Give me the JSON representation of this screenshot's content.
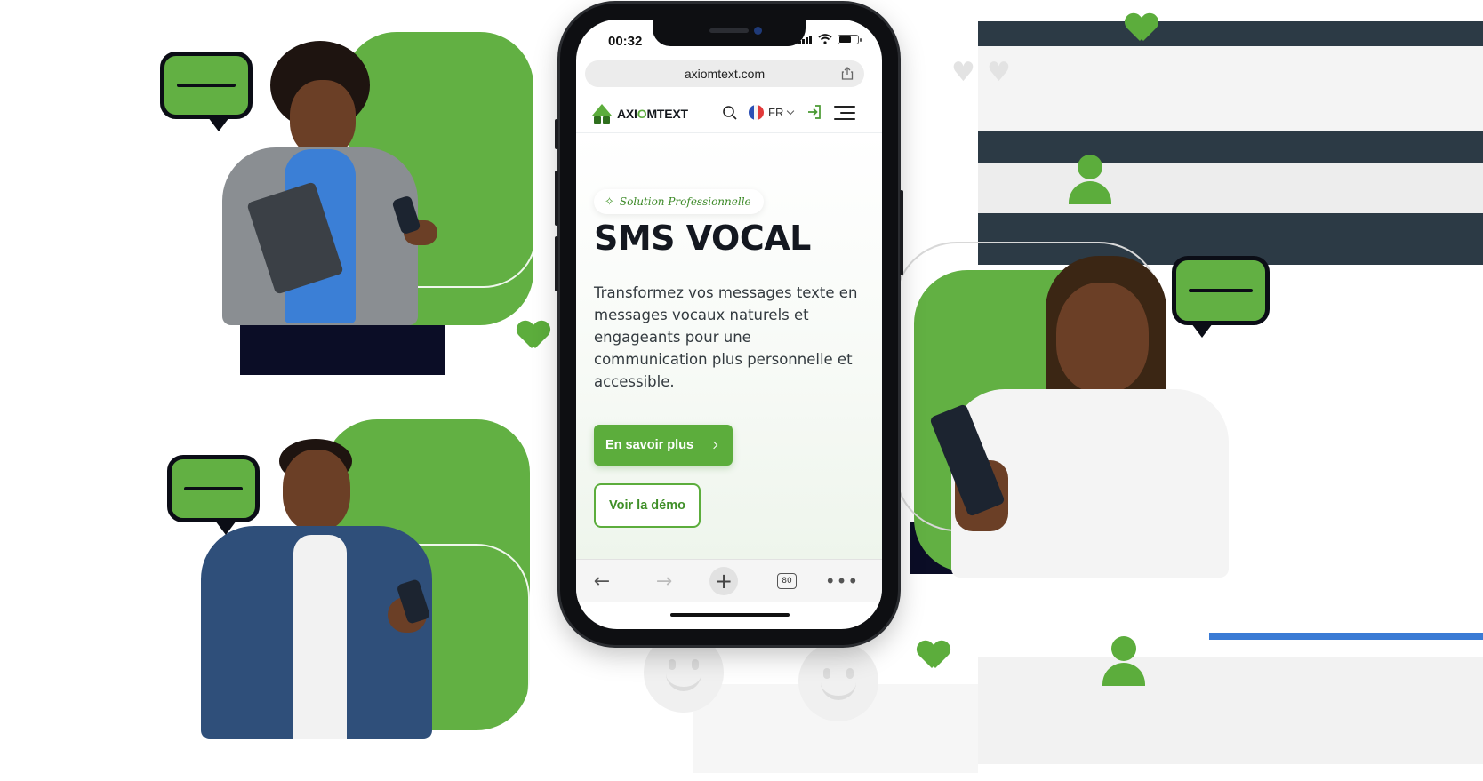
{
  "phone": {
    "status_time": "00:32",
    "url": "axiomtext.com"
  },
  "site": {
    "logo_prefix": "AXI",
    "logo_o": "O",
    "logo_suffix": "MTEXT",
    "lang": "FR",
    "badge": "Solution Professionnelle",
    "title": "SMS VOCAL",
    "description": "Transformez vos messages texte en messages vocaux naturels et engageants pour une communication plus personnelle et accessible.",
    "cta_primary": "En savoir plus",
    "cta_secondary": "Voir la démo"
  },
  "browser": {
    "tab_count": "80"
  },
  "colors": {
    "brand_green": "#5cad3c",
    "dark_navy": "#0b0d26",
    "text_dark": "#141820"
  },
  "icons": [
    "search-icon",
    "flag-fr-icon",
    "login-icon",
    "menu-icon",
    "share-icon",
    "back-icon",
    "forward-icon",
    "plus-icon",
    "tabs-icon",
    "more-icon",
    "sparkle-icon",
    "speech-bubble-icon",
    "heart-icon",
    "user-icon",
    "smiley-icon"
  ]
}
